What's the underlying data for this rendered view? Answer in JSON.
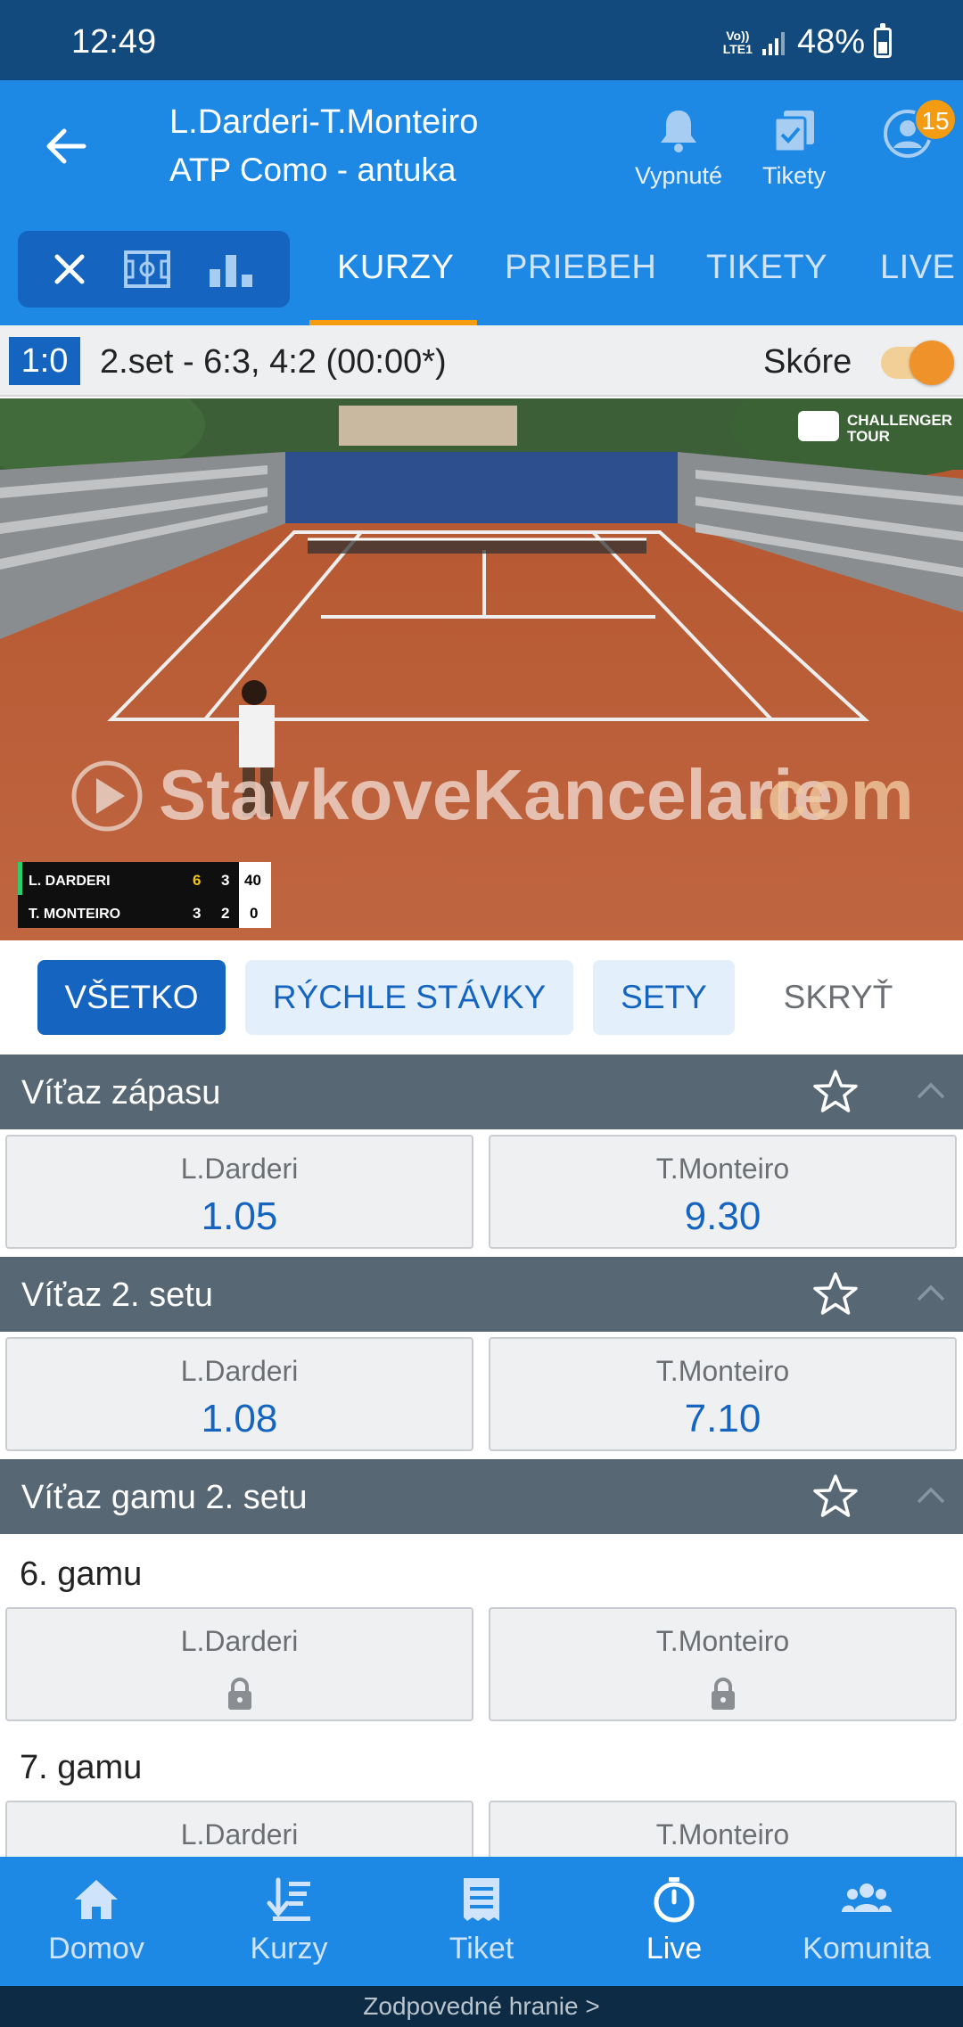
{
  "status_bar": {
    "time": "12:49",
    "volte_top": "Vo))",
    "volte_bottom": "LTE1",
    "battery": "48%"
  },
  "header": {
    "title": "L.Darderi-T.Monteiro",
    "subtitle": "ATP Como - antuka",
    "notifications_label": "Vypnuté",
    "tickets_label": "Tikety",
    "profile_badge": "15"
  },
  "tabs": [
    {
      "label": "KURZY",
      "active": true
    },
    {
      "label": "PRIEBEH",
      "active": false
    },
    {
      "label": "TIKETY",
      "active": false
    },
    {
      "label": "LIVE",
      "active": false
    }
  ],
  "score": {
    "sets": "1:0",
    "detail": "2.set - 6:3, 4:2 (00:00*)",
    "toggle_label": "Skóre",
    "toggle_on": true
  },
  "video": {
    "watermark": "StavkoveKancelarie",
    "watermark_suffix": ".com",
    "logo_line1": "CHALLENGER",
    "logo_line2": "TOUR",
    "scoreboard": [
      {
        "player": "L. DARDERI",
        "set1": "6",
        "set2": "3",
        "points": "40"
      },
      {
        "player": "T. MONTEIRO",
        "set1": "3",
        "set2": "2",
        "points": "0"
      }
    ]
  },
  "filters": [
    {
      "label": "VŠETKO",
      "active": true
    },
    {
      "label": "RÝCHLE STÁVKY",
      "active": false
    },
    {
      "label": "SETY",
      "active": false
    },
    {
      "label": "SKRYŤ",
      "active": false
    }
  ],
  "markets": {
    "match_winner": {
      "title": "Víťaz zápasu",
      "odds": [
        {
          "name": "L.Darderi",
          "value": "1.05"
        },
        {
          "name": "T.Monteiro",
          "value": "9.30"
        }
      ]
    },
    "set2_winner": {
      "title": "Víťaz 2. setu",
      "odds": [
        {
          "name": "L.Darderi",
          "value": "1.08"
        },
        {
          "name": "T.Monteiro",
          "value": "7.10"
        }
      ]
    },
    "game_winner": {
      "title": "Víťaz gamu 2. setu",
      "games": [
        {
          "label": "6. gamu",
          "odds": [
            {
              "name": "L.Darderi",
              "locked": true
            },
            {
              "name": "T.Monteiro",
              "locked": true
            }
          ]
        },
        {
          "label": "7. gamu",
          "odds": [
            {
              "name": "L.Darderi"
            },
            {
              "name": "T.Monteiro"
            }
          ]
        }
      ]
    }
  },
  "bottom_nav": [
    {
      "label": "Domov",
      "icon": "home-icon",
      "active": false
    },
    {
      "label": "Kurzy",
      "icon": "odds-icon",
      "active": false
    },
    {
      "label": "Tiket",
      "icon": "ticket-icon",
      "active": false
    },
    {
      "label": "Live",
      "icon": "stopwatch-icon",
      "active": true
    },
    {
      "label": "Komunita",
      "icon": "community-icon",
      "active": false
    }
  ],
  "footer": {
    "text": "Zodpovedné hranie >"
  },
  "colors": {
    "primary": "#1e88e5",
    "dark_primary": "#1565c0",
    "status_bar": "#124a7d",
    "accent": "#f39c12",
    "market_header": "#586774"
  }
}
